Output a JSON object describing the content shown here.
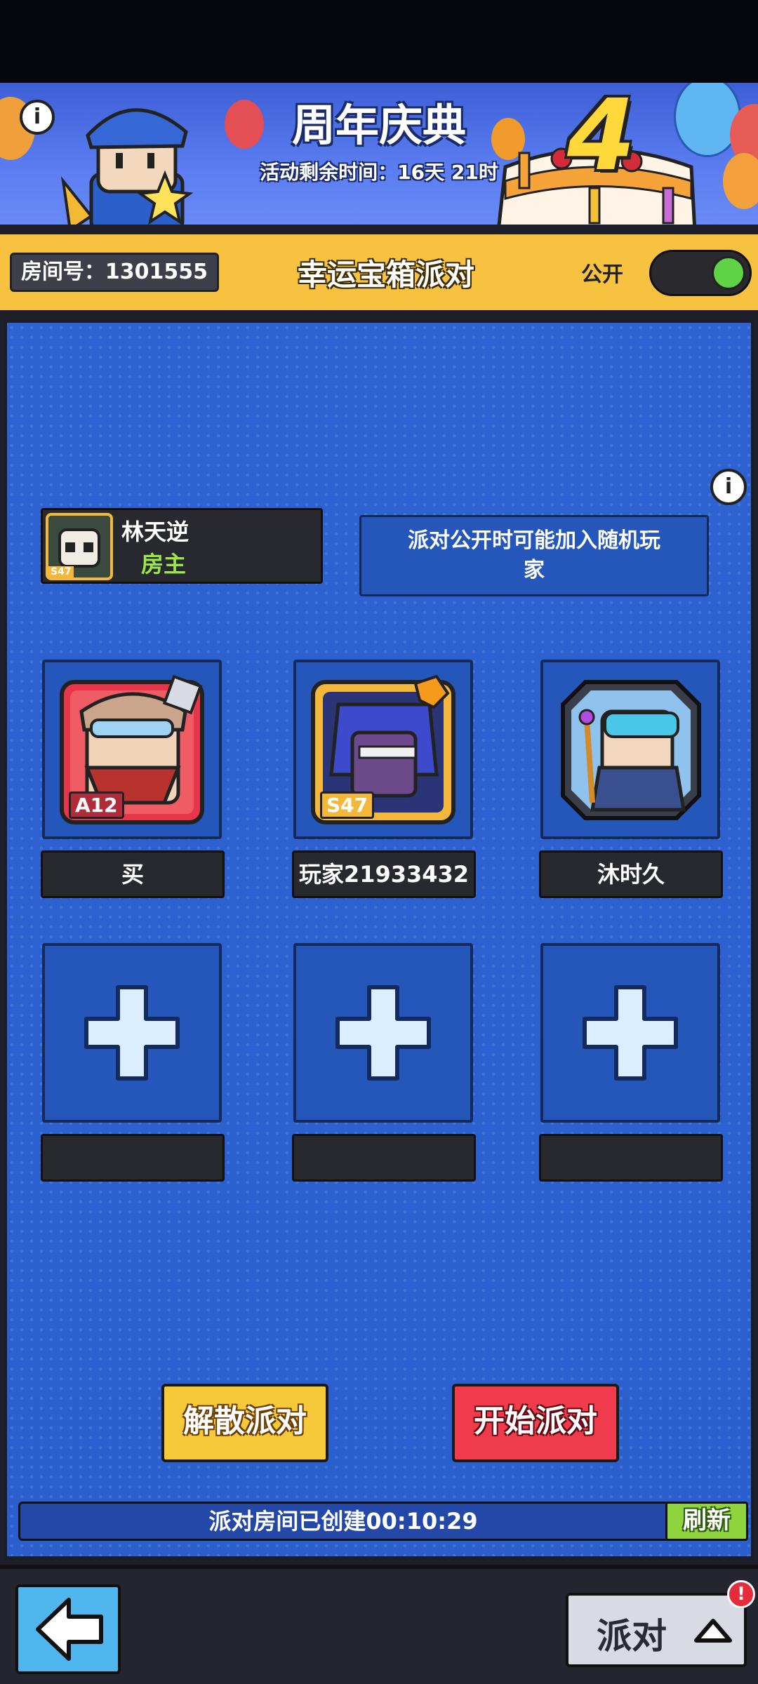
{
  "banner": {
    "title": "周年庆典",
    "timer": "活动剩余时间：16天 21时",
    "anniversary_number": "4"
  },
  "header": {
    "room_number": "房间号：1301555",
    "room_title": "幸运宝箱派对",
    "public_label": "公开",
    "public_toggle": true
  },
  "host": {
    "name": "林天逆",
    "role": "房主",
    "rank_badge": "S47"
  },
  "notice": "派对公开时可能加入随机玩家",
  "members": [
    {
      "name": "买",
      "rank_badge": "A12"
    },
    {
      "name": "玩家21933432",
      "rank_badge": "S47"
    },
    {
      "name": "沐时久",
      "rank_badge": ""
    }
  ],
  "empty_slots": [
    {
      "name": ""
    },
    {
      "name": ""
    },
    {
      "name": ""
    }
  ],
  "actions": {
    "disband": "解散派对",
    "start": "开始派对"
  },
  "status": {
    "created_text": "派对房间已创建00:10:29",
    "refresh": "刷新"
  },
  "footer": {
    "party_button": "派对",
    "notification_badge": "!"
  },
  "colors": {
    "header_yellow": "#f6c23f",
    "panel_blue": "#2b5fce",
    "start_red": "#ef3b4b",
    "disband_yellow": "#f6c93a",
    "refresh_green": "#8ed43c",
    "toggle_green": "#5fd246"
  }
}
